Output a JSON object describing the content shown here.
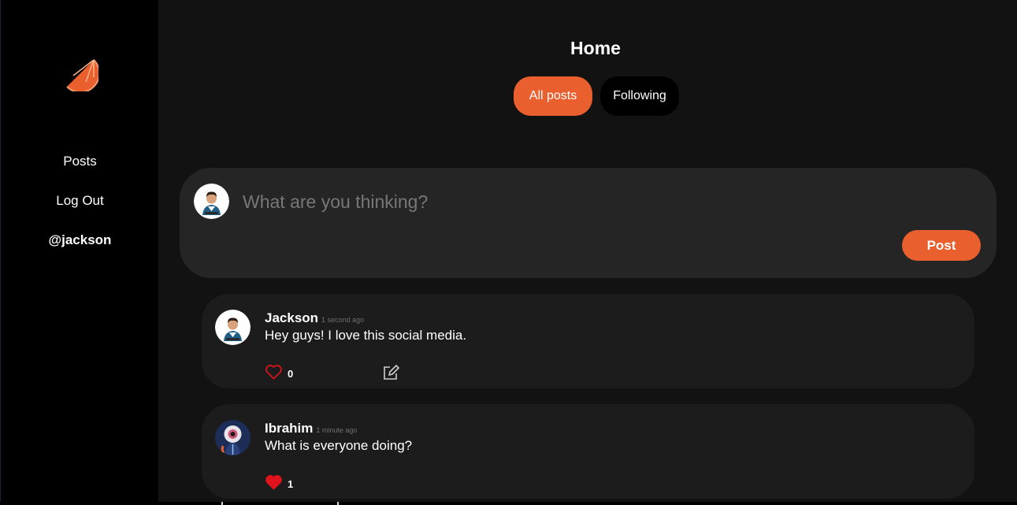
{
  "sidebar": {
    "logo_icon": "orange-slice-icon",
    "items": [
      {
        "label": "Posts"
      },
      {
        "label": "Log Out"
      },
      {
        "label": "@jackson"
      }
    ]
  },
  "header": {
    "title": "Home",
    "tabs": [
      {
        "label": "All posts",
        "active": true
      },
      {
        "label": "Following",
        "active": false
      }
    ]
  },
  "composer": {
    "placeholder": "What are you thinking?",
    "value": "",
    "post_label": "Post"
  },
  "posts": [
    {
      "author": "Jackson",
      "time": "1 second ago",
      "body": "Hey guys! I love this social media.",
      "likes": "0",
      "liked": false,
      "editable": true
    },
    {
      "author": "Ibrahim",
      "time": "1 minute ago",
      "body": "What is everyone doing?",
      "likes": "1",
      "liked": true,
      "editable": false
    }
  ],
  "colors": {
    "accent": "#e9602e",
    "background": "#121212",
    "sidebar": "#000000",
    "card": "#1c1c1c",
    "composer": "#252525",
    "like": "#e0121b"
  }
}
